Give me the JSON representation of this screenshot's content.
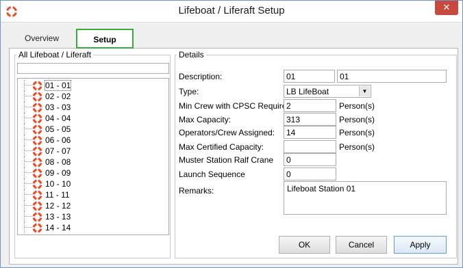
{
  "window": {
    "title": "Lifeboat / Liferaft Setup",
    "close_symbol": "✕"
  },
  "tabs": [
    {
      "label": "Overview",
      "active": false
    },
    {
      "label": "Setup",
      "active": true
    }
  ],
  "left_panel": {
    "title": "All Lifeboat / Liferaft",
    "search_value": "",
    "items": [
      "01 - 01",
      "02 - 02",
      "03 - 03",
      "04 - 04",
      "05 - 05",
      "06 - 06",
      "07 - 07",
      "08 - 08",
      "09 - 09",
      "10 - 10",
      "11 - 11",
      "12 - 12",
      "13 - 13",
      "14 - 14"
    ],
    "selected_index": 0
  },
  "details": {
    "title": "Details",
    "description_label": "Description:",
    "description_code": "01",
    "description_name": "01",
    "type_label": "Type:",
    "type_value": "LB LifeBoat",
    "min_crew_label": "Min Crew with CPSC Required:",
    "min_crew_value": "2",
    "max_capacity_label": "Max Capacity:",
    "max_capacity_value": "313",
    "operators_label": "Operators/Crew Assigned:",
    "operators_value": "14",
    "max_certified_label": "Max Certified Capacity:",
    "max_certified_value": "",
    "muster_label": "Muster Station Ralf Crane",
    "muster_value": "0",
    "launch_label": "Launch Sequence",
    "launch_value": "0",
    "remarks_label": "Remarks:",
    "remarks_value": "Lifeboat Station 01",
    "unit": "Person(s)"
  },
  "buttons": {
    "ok": "OK",
    "cancel": "Cancel",
    "apply": "Apply"
  },
  "colors": {
    "active_tab_border": "#3aa83a",
    "close_button": "#c74a3f",
    "lifebuoy": "#e0502a"
  }
}
